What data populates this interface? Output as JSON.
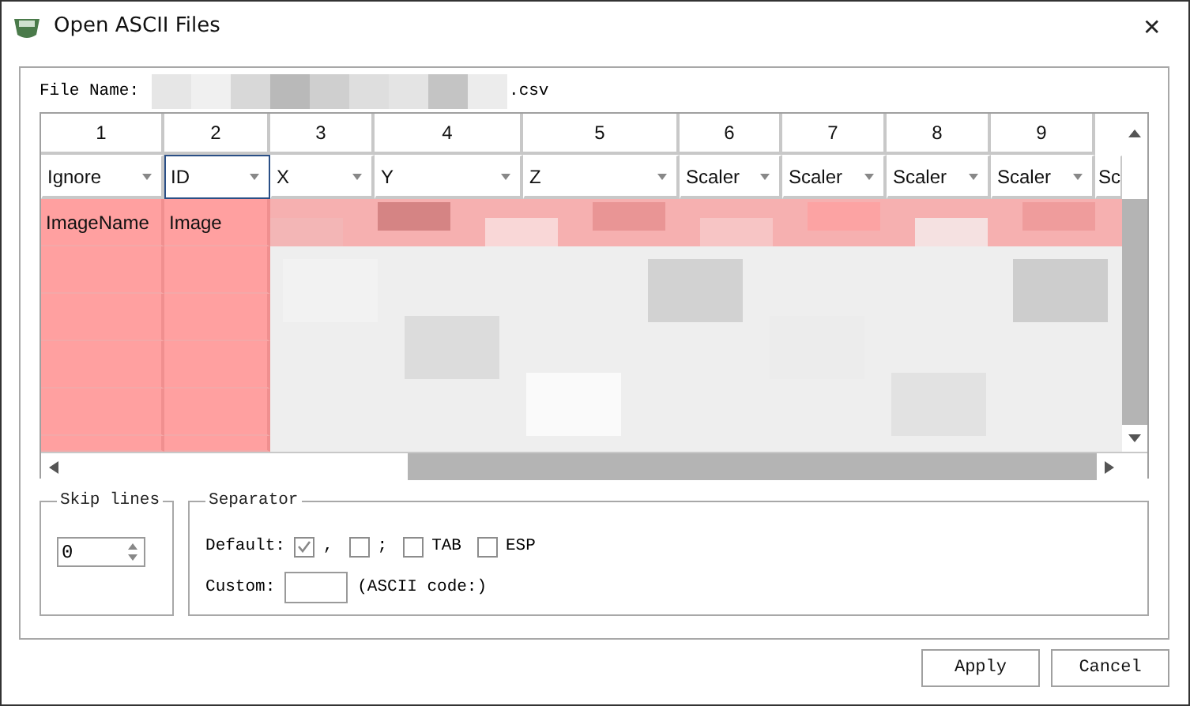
{
  "window": {
    "title": "Open ASCII Files",
    "close": "✕"
  },
  "file_name": {
    "label": "File Name:",
    "suffix": ".csv"
  },
  "grid": {
    "columns": [
      {
        "number": "1",
        "type": "Ignore",
        "focused": false
      },
      {
        "number": "2",
        "type": "ID",
        "focused": true
      },
      {
        "number": "3",
        "type": "X",
        "focused": false
      },
      {
        "number": "4",
        "type": "Y",
        "focused": false
      },
      {
        "number": "5",
        "type": "Z",
        "focused": false
      },
      {
        "number": "6",
        "type": "Scaler",
        "focused": false
      },
      {
        "number": "7",
        "type": "Scaler",
        "focused": false
      },
      {
        "number": "8",
        "type": "Scaler",
        "focused": false
      },
      {
        "number": "9",
        "type": "Scaler",
        "focused": false
      },
      {
        "type": "Sc",
        "focused": false
      }
    ],
    "first_row": [
      "ImageName",
      "Image"
    ]
  },
  "skip_lines": {
    "title": "Skip lines",
    "value": "0"
  },
  "separator": {
    "title": "Separator",
    "default_label": "Default:",
    "options": [
      {
        "label": ",",
        "checked": true
      },
      {
        "label": ";",
        "checked": false
      },
      {
        "label": "TAB",
        "checked": false
      },
      {
        "label": "ESP",
        "checked": false
      }
    ],
    "custom_label": "Custom:",
    "custom_hint": "(ASCII code:)"
  },
  "buttons": [
    "Apply",
    "Cancel"
  ]
}
